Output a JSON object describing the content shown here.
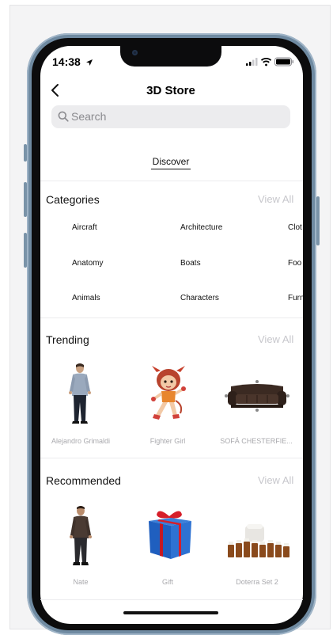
{
  "status_bar": {
    "time": "14:38"
  },
  "nav": {
    "title": "3D Store"
  },
  "search": {
    "placeholder": "Search"
  },
  "tabs": [
    {
      "label": "Discover",
      "active": true
    }
  ],
  "categories": {
    "title": "Categories",
    "view_all": "View All",
    "items": [
      "Aircraft",
      "Architecture",
      "Clot",
      "Anatomy",
      "Boats",
      "Foo",
      "Animals",
      "Characters",
      "Furn"
    ]
  },
  "trending": {
    "title": "Trending",
    "view_all": "View All",
    "items": [
      {
        "label": "Alejandro Grimaldi",
        "icon": "man-figure"
      },
      {
        "label": "Fighter Girl",
        "icon": "cartoon-girl-figure"
      },
      {
        "label": "SOFÁ CHESTERFIE...",
        "icon": "sofa"
      }
    ]
  },
  "recommended": {
    "title": "Recommended",
    "view_all": "View All",
    "items": [
      {
        "label": "Nate",
        "icon": "man-figure"
      },
      {
        "label": "Gift",
        "icon": "gift-box"
      },
      {
        "label": "Doterra Set 2",
        "icon": "bottle-set"
      }
    ]
  },
  "colors": {
    "accent_text": "#111111",
    "muted": "#c7c7cc",
    "label": "#a9a9ad",
    "search_bg": "#ececee",
    "phone_frame": "#6f8aa1"
  }
}
